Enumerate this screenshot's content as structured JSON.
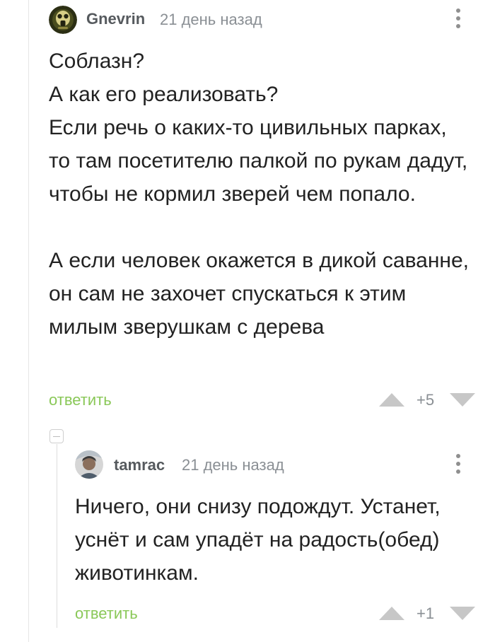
{
  "comment": {
    "author": "Gnevrin",
    "date": "21 день назад",
    "avatar_icon": "gas-mask-avatar",
    "paragraphs": [
      "Соблазн?\nА как его реализовать?\nЕсли речь о каких-то цивильных парках, то там посетителю палкой по рукам дадут, чтобы не кормил зверей чем попало.",
      "А если человек окажется в дикой саванне, он сам не захочет спускаться к этим милым зверушкам с дерева"
    ],
    "reply_label": "ответить",
    "rating": "+5"
  },
  "reply": {
    "author": "tamrac",
    "date": "21 день назад",
    "avatar_icon": "user-photo-avatar",
    "paragraphs": [
      "Ничего, они снизу подождут. Устанет, уснёт и сам упадёт на радость(обед) животинкам."
    ],
    "reply_label": "ответить",
    "rating": "+1"
  },
  "colors": {
    "reply_link": "#8ac858",
    "meta_text": "#8a8f94",
    "vote_arrow": "#c7c7c7",
    "thread_line": "#e6e6e6"
  }
}
